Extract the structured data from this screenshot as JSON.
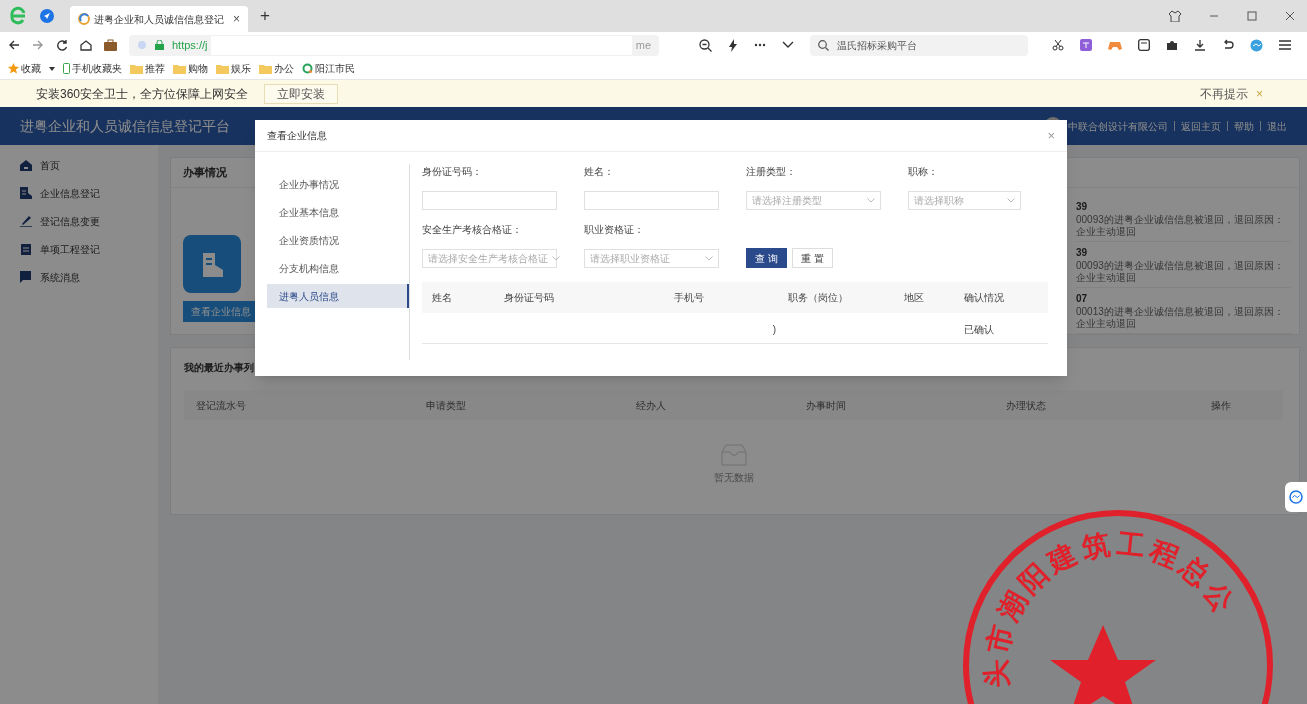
{
  "browser": {
    "tabs": [
      {
        "title": "进粤企业和人员诚信信息登记",
        "close": "×",
        "selected": true
      }
    ],
    "new_tab": "+",
    "address": {
      "scheme": "https://j",
      "tail": "me"
    },
    "search": {
      "value": "温氏招标采购平台"
    },
    "bookmarks": [
      {
        "kind": "star",
        "label": "收藏"
      },
      {
        "kind": "phone",
        "label": "手机收藏夹"
      },
      {
        "kind": "folder",
        "label": "推荐"
      },
      {
        "kind": "folder",
        "label": "购物"
      },
      {
        "kind": "folder",
        "label": "娱乐"
      },
      {
        "kind": "folder",
        "label": "办公"
      },
      {
        "kind": "site",
        "label": "阳江市民"
      }
    ],
    "infobar": {
      "text": "安装360安全卫士，全方位保障上网安全",
      "button": "立即安装",
      "dismiss": "不再提示",
      "close": "×"
    }
  },
  "app": {
    "title": "进粤企业和人员诚信信息登记平台",
    "header_links": [
      "中联合创设计有限公司",
      "返回主页",
      "帮助",
      "退出"
    ],
    "sidebar": [
      {
        "kind": "home",
        "label": "首页"
      },
      {
        "kind": "building",
        "label": "企业信息登记"
      },
      {
        "kind": "pen",
        "label": "登记信息变更"
      },
      {
        "kind": "clipboard",
        "label": "单项工程登记"
      },
      {
        "kind": "chat",
        "label": "系统消息"
      }
    ],
    "status_card": {
      "title": "办事情况",
      "button": "查看企业信息",
      "messages": [
        {
          "time": "39",
          "text": "00093的进粤企业诚信信息被退回，退回原因：企业主动退回"
        },
        {
          "time": "39",
          "text": "00093的进粤企业诚信信息被退回，退回原因：企业主动退回"
        },
        {
          "time": "07",
          "text": "00013的进粤企业诚信信息被退回，退回原因：企业主动退回"
        }
      ]
    },
    "recent": {
      "title": "我的最近办事列",
      "columns": [
        "登记流水号",
        "申请类型",
        "经办人",
        "办事时间",
        "办理状态",
        "操作"
      ],
      "empty": "暂无数据"
    }
  },
  "modal": {
    "title": "查看企业信息",
    "close": "×",
    "menu": [
      {
        "label": "企业办事情况",
        "selected": false
      },
      {
        "label": "企业基本信息",
        "selected": false
      },
      {
        "label": "企业资质情况",
        "selected": false
      },
      {
        "label": "分支机构信息",
        "selected": false
      },
      {
        "label": "进粤人员信息",
        "selected": true
      }
    ],
    "filters": [
      {
        "kind": "input",
        "label": "身份证号码："
      },
      {
        "kind": "input",
        "label": "姓名："
      },
      {
        "kind": "select",
        "label": "注册类型：",
        "placeholder": "请选择注册类型"
      },
      {
        "kind": "select",
        "label": "职称：",
        "placeholder": "请选择职称"
      },
      {
        "kind": "select",
        "label": "安全生产考核合格证：",
        "placeholder": "请选择安全生产考核合格证"
      },
      {
        "kind": "select",
        "label": "职业资格证：",
        "placeholder": "请选择职业资格证"
      }
    ],
    "buttons": [
      {
        "kind": "primary",
        "label": "查 询"
      },
      {
        "kind": "plain",
        "label": "重 置"
      }
    ],
    "table": {
      "columns": [
        "姓名",
        "身份证号码",
        "手机号",
        "职务（岗位）",
        "地区",
        "确认情况"
      ],
      "rows": [
        {
          "column_3": ")",
          "column_6": "已确认"
        }
      ]
    }
  },
  "stamp": {
    "text": "头市潮阳建筑工程总公"
  }
}
